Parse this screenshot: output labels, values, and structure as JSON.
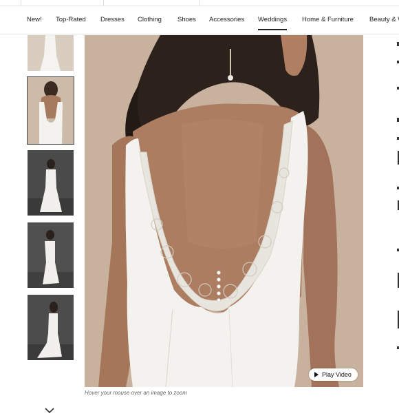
{
  "nav": {
    "items": [
      "New!",
      "Top-Rated",
      "Dresses",
      "Clothing",
      "Shoes",
      "Accessories",
      "Weddings",
      "Home & Furniture",
      "Beauty & W"
    ],
    "active": "Weddings"
  },
  "gallery": {
    "thumbnails": [
      "front view",
      "back view",
      "front full view",
      "side view",
      "back full view"
    ],
    "selected_index": 1,
    "scroll_icon": "chevron-down-icon"
  },
  "main_image": {
    "description_icon": "wedding-dress-back-lace"
  },
  "video": {
    "label": "Play Video",
    "icon": "play-icon"
  },
  "hint": {
    "text": "Hover your mouse over an image to zoom"
  },
  "colors": {
    "accent": "#222222",
    "photo_bg": "#cbb6a2",
    "dress": "#f3f2ef"
  }
}
